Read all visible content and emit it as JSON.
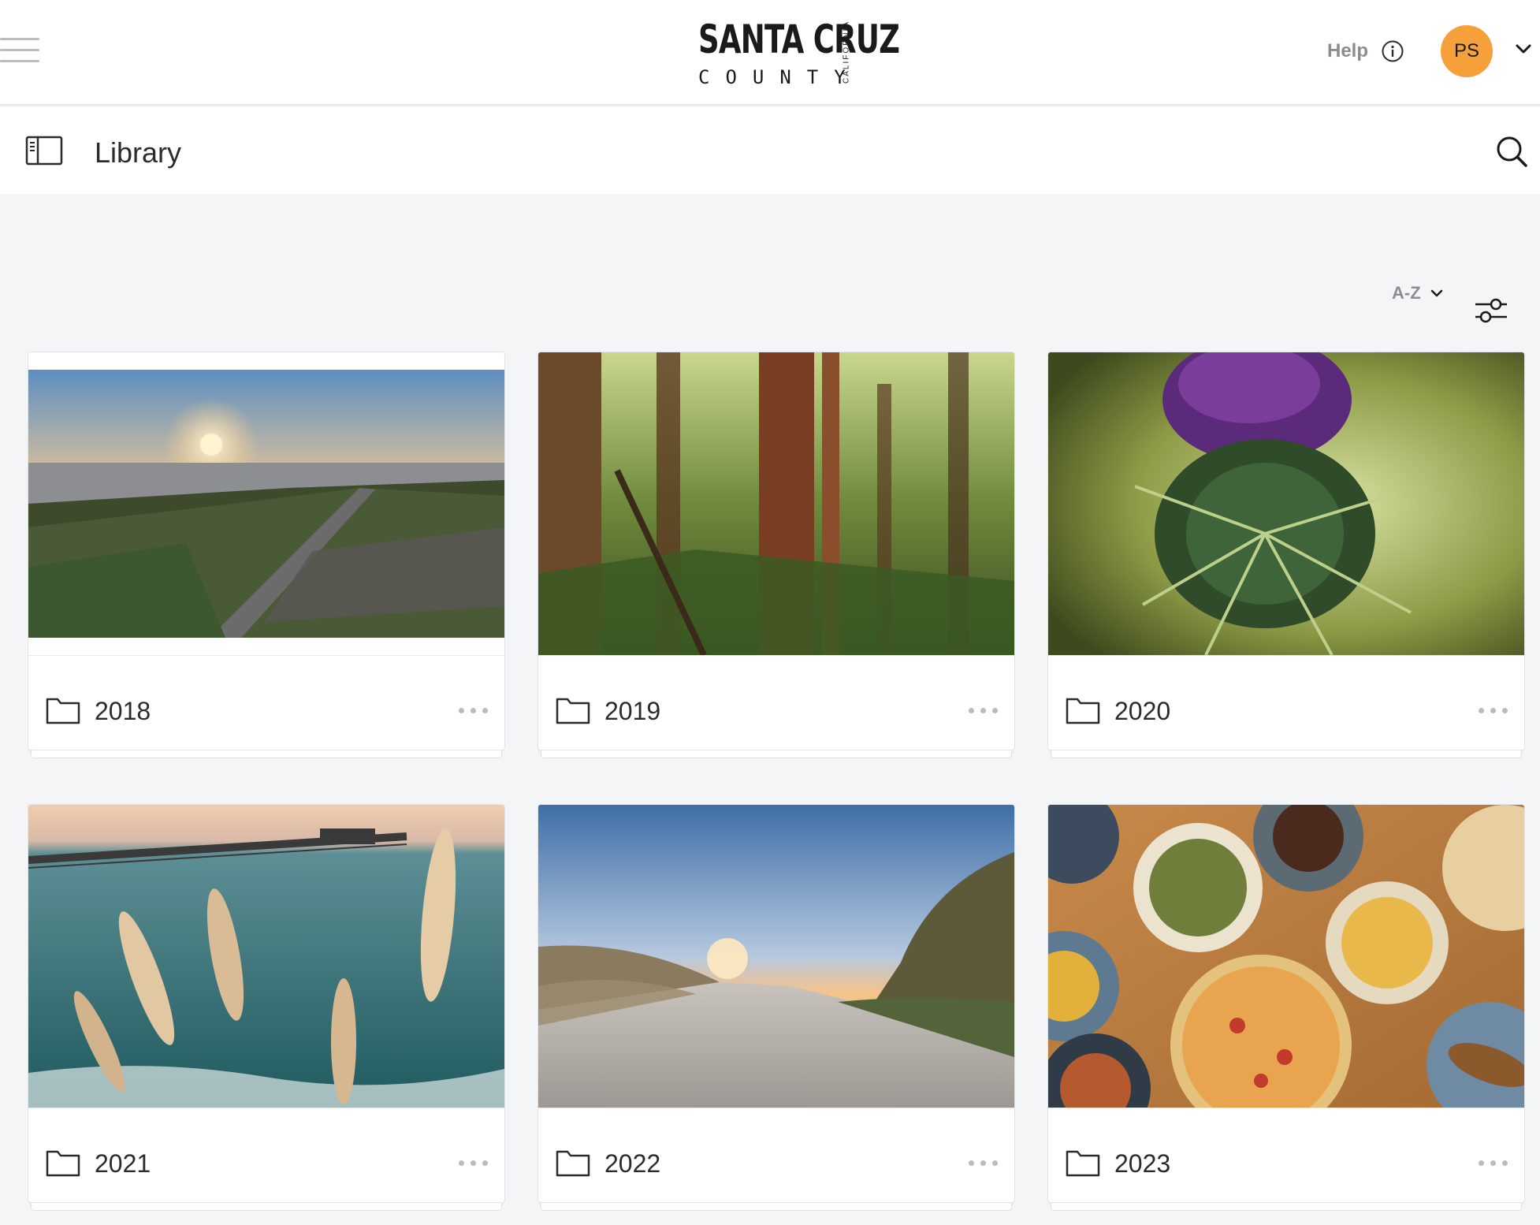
{
  "header": {
    "logo_main": "SANTA CRUZ",
    "logo_sub": "COUNTY",
    "logo_side": "CALIFORNIA",
    "help_label": "Help",
    "avatar_initials": "PS"
  },
  "subheader": {
    "title": "Library"
  },
  "toolbar": {
    "sort_label": "A-Z"
  },
  "folders": [
    {
      "label": "2018",
      "image": "coastal-sunset-aerial"
    },
    {
      "label": "2019",
      "image": "redwood-forest"
    },
    {
      "label": "2020",
      "image": "thistle-flower"
    },
    {
      "label": "2021",
      "image": "pier-and-pampas-grass"
    },
    {
      "label": "2022",
      "image": "beach-dune-sunset"
    },
    {
      "label": "2023",
      "image": "food-table-overhead"
    }
  ],
  "colors": {
    "avatar": "#f5a03a",
    "background": "#f4f5f7",
    "muted_text": "#8a8d93"
  },
  "icons": {
    "menu": "hamburger-icon",
    "help": "info-icon",
    "avatar_menu": "chevron-down-icon",
    "sidebar_toggle": "panel-toggle-icon",
    "search": "search-icon",
    "sort": "chevron-down-icon",
    "filter": "sliders-icon",
    "folder": "folder-icon",
    "more": "more-horizontal-icon"
  }
}
